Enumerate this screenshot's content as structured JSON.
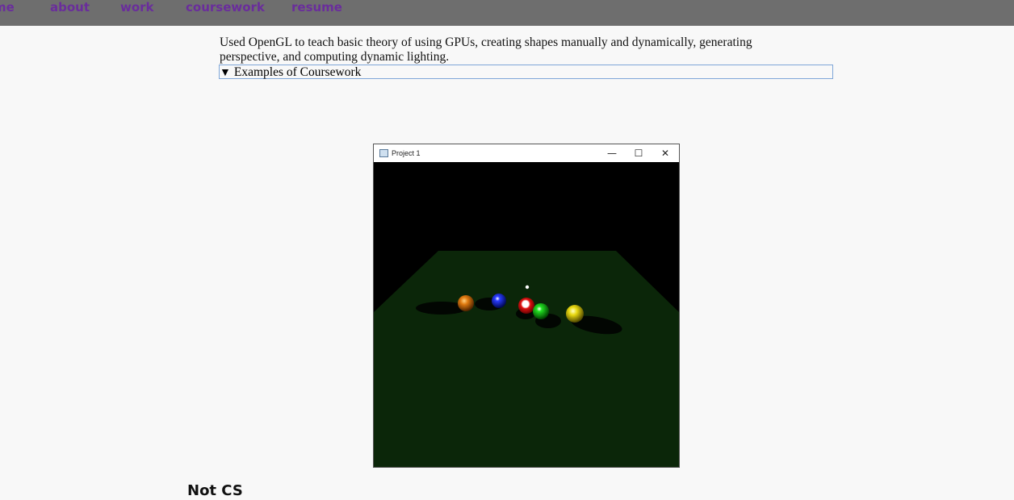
{
  "nav": {
    "items": [
      {
        "label": "me"
      },
      {
        "label": "about"
      },
      {
        "label": "work"
      },
      {
        "label": "coursework"
      },
      {
        "label": "resume"
      }
    ],
    "link_color": "#6a2d9c",
    "bar_color": "#6e6e6e"
  },
  "description": "Used OpenGL to teach basic theory of using GPUs, creating shapes manually and dynamically, generating perspective, and computing dynamic lighting.",
  "details": {
    "marker": "▼",
    "summary": "Examples of Coursework",
    "expanded": true
  },
  "app_window": {
    "title": "Project 1",
    "minimize_glyph": "—",
    "maximize_glyph": "☐",
    "close_glyph": "✕",
    "scene": {
      "table_color": "#0b2609",
      "background_color": "#000000",
      "balls": [
        {
          "name": "orange-ball",
          "color": "#e07a10"
        },
        {
          "name": "blue-ball",
          "color": "#1020e0"
        },
        {
          "name": "red-ball",
          "color": "#e01010"
        },
        {
          "name": "green-ball",
          "color": "#10d010"
        },
        {
          "name": "yellow-ball",
          "color": "#e8d810"
        }
      ]
    }
  },
  "section_heading": "Not CS"
}
